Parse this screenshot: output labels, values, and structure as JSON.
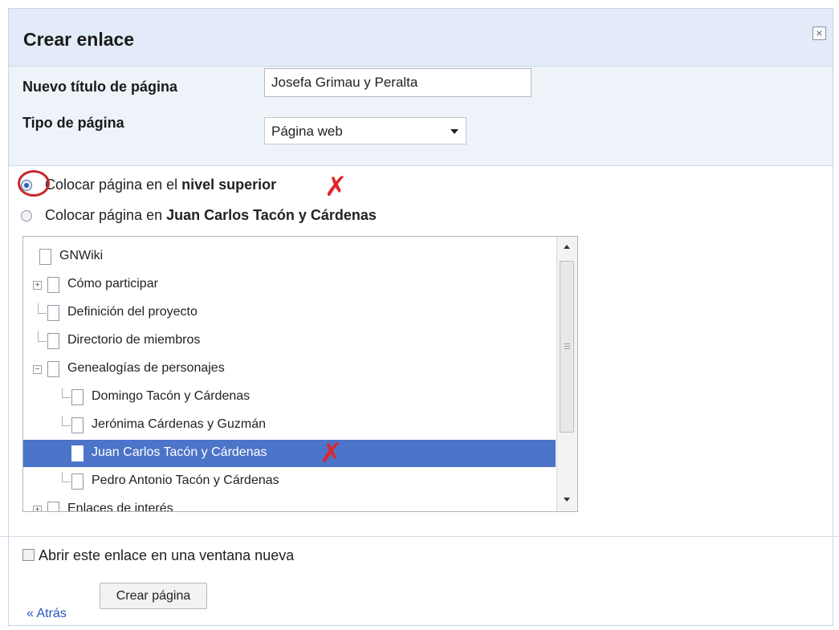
{
  "dialog": {
    "title": "Crear enlace",
    "close_icon": "close-icon"
  },
  "form": {
    "page_title_label": "Nuevo título de página",
    "page_title_value": "Josefa Grimau y Peralta",
    "page_type_label": "Tipo de página",
    "page_type_value": "Página web"
  },
  "placement": {
    "option_top_prefix": "Colocar página en el ",
    "option_top_bold": "nivel superior",
    "option_under_prefix": "Colocar página en ",
    "option_under_bold": "Juan Carlos Tacón y Cárdenas",
    "selected": "top"
  },
  "tree": {
    "items": [
      {
        "label": "GNWiki",
        "level": 0,
        "toggle": "none",
        "selected": false
      },
      {
        "label": "Cómo participar",
        "level": 1,
        "toggle": "expand",
        "selected": false
      },
      {
        "label": "Definición del proyecto",
        "level": 1,
        "toggle": "branch",
        "selected": false
      },
      {
        "label": "Directorio de miembros",
        "level": 1,
        "toggle": "branch",
        "selected": false
      },
      {
        "label": "Genealogías de personajes",
        "level": 1,
        "toggle": "collapse",
        "selected": false
      },
      {
        "label": "Domingo Tacón y Cárdenas",
        "level": 2,
        "toggle": "branch",
        "selected": false
      },
      {
        "label": "Jerónima Cárdenas y Guzmán",
        "level": 2,
        "toggle": "branch",
        "selected": false
      },
      {
        "label": "Juan Carlos Tacón y Cárdenas",
        "level": 2,
        "toggle": "none",
        "selected": true
      },
      {
        "label": "Pedro Antonio Tacón y Cárdenas",
        "level": 2,
        "toggle": "branch",
        "selected": false
      },
      {
        "label": "Enlaces de interés",
        "level": 1,
        "toggle": "expand",
        "selected": false
      }
    ]
  },
  "footer": {
    "new_window_label": "Abrir este enlace en una ventana nueva",
    "back_link": "« Atrás",
    "create_button": "Crear página"
  },
  "colors": {
    "title_bar": "#e2ebf7",
    "selection": "#4c74c8",
    "annotation_red": "#e0262b",
    "link": "#2a55c2"
  }
}
